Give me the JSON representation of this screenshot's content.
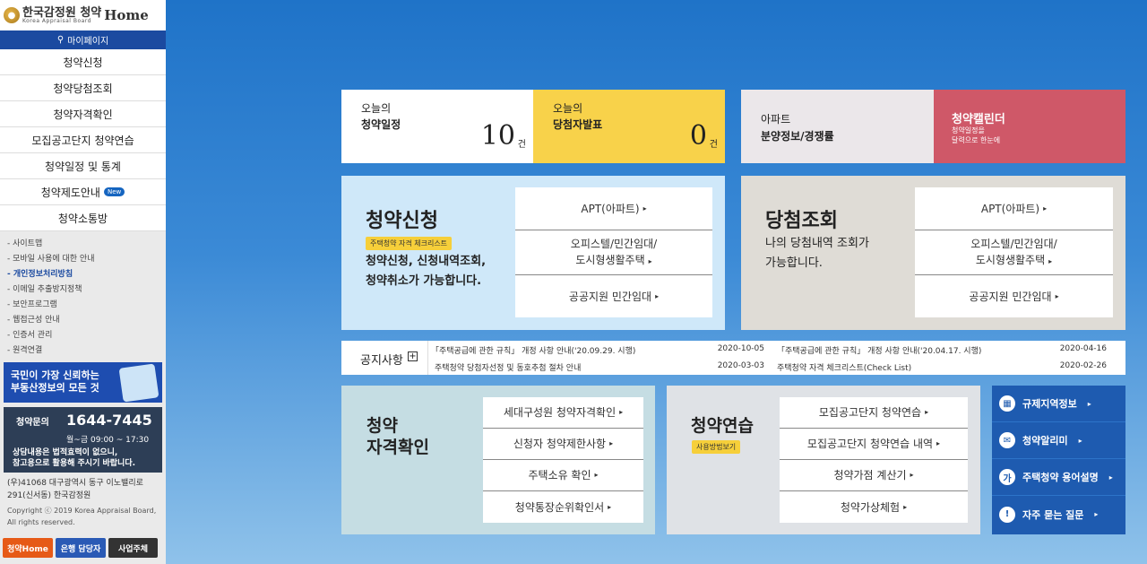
{
  "logo": {
    "korean": "한국감정원 청약",
    "english": "Korea Appraisal Board",
    "home": "Home"
  },
  "sidebar": {
    "mypage": "마이페이지",
    "menu": [
      "청약신청",
      "청약당첨조회",
      "청약자격확인",
      "모집공고단지 청약연습",
      "청약일정 및 통계",
      "청약제도안내",
      "청약소통방"
    ],
    "new_badge": "New",
    "links": [
      "- 사이트맵",
      "- 모바일 사용에 대한 안내",
      "- 개인정보처리방침",
      "- 이메일 추출방지정책",
      "- 보안프로그램",
      "- 웹접근성 안내",
      "- 인증서 관리",
      "- 원격연결"
    ],
    "banner": {
      "line1": "국민이 가장 신뢰하는",
      "line2": "부동산정보의 모든 것"
    },
    "contact": {
      "label": "청약문의",
      "number": "1644-7445",
      "hours": "월~금 09:00 ~ 17:30",
      "note1": "상담내용은 법적효력이 없으니,",
      "note2": "참고용으로 활용해 주시기 바랍니다."
    },
    "address": "(우)41068 대구광역시 동구 이노밸리로 291(신서동) 한국감정원",
    "copyright1": "Copyright ⓒ 2019 Korea Appraisal Board,",
    "copyright2": "All rights reserved.",
    "bottom_buttons": [
      "청약Home",
      "은행 담당자",
      "사업주체"
    ]
  },
  "stats": {
    "today_schedule": {
      "line1": "오늘의",
      "line2": "청약일정",
      "count": "10",
      "unit": "건"
    },
    "today_winners": {
      "line1": "오늘의",
      "line2": "당첨자발표",
      "count": "0",
      "unit": "건"
    },
    "apt": {
      "line1": "아파트",
      "line2": "분양정보/경쟁률"
    },
    "calendar": {
      "title": "청약캘린더",
      "desc1": "청약일정을",
      "desc2": "달력으로 한눈에"
    }
  },
  "apply": {
    "title": "청약신청",
    "tag": "주택청약 자격 체크리스트",
    "desc1": "청약신청, 신청내역조회,",
    "desc2": "청약취소가 가능합니다.",
    "buttons": [
      "APT(아파트)",
      "오피스텔/민간임대/",
      "도시형생활주택",
      "공공지원 민간임대"
    ]
  },
  "win": {
    "title": "당첨조회",
    "desc1": "나의 당첨내역 조회가",
    "desc2": "가능합니다.",
    "buttons": [
      "APT(아파트)",
      "오피스텔/민간임대/",
      "도시형생활주택",
      "공공지원 민간임대"
    ]
  },
  "notice": {
    "title": "공지사항",
    "plus": "+",
    "items": [
      {
        "text": "「주택공급에 관한 규칙」 개정 사항 안내('20.09.29. 시행)",
        "date": "2020-10-05"
      },
      {
        "text": "「주택공급에 관한 규칙」 개정 사항 안내('20.04.17. 시행)",
        "date": "2020-04-16"
      },
      {
        "text": "주택청약 당첨자선정 및 동호추첨 절차 안내",
        "date": "2020-03-03"
      },
      {
        "text": "주택청약 자격 체크리스트(Check List)",
        "date": "2020-02-26"
      }
    ]
  },
  "qualify": {
    "title1": "청약",
    "title2": "자격확인",
    "buttons": [
      "세대구성원 청약자격확인",
      "신청자 청약제한사항",
      "주택소유 확인",
      "청약통장순위확인서"
    ]
  },
  "practice": {
    "title": "청약연습",
    "tag": "사용방법보기",
    "buttons": [
      "모집공고단지 청약연습",
      "모집공고단지 청약연습 내역",
      "청약가점 계산기",
      "청약가상체험"
    ]
  },
  "quick": [
    "규제지역정보",
    "청약알리미",
    "주택청약 용어설명",
    "자주 묻는 질문"
  ],
  "colors": {
    "navy": "#1b4aa0",
    "yellow": "#f8d24a",
    "rose": "#cf5868",
    "lightblue": "#cfe8f9",
    "beige": "#dfdcd6",
    "quickblue": "#1e5bb0"
  }
}
